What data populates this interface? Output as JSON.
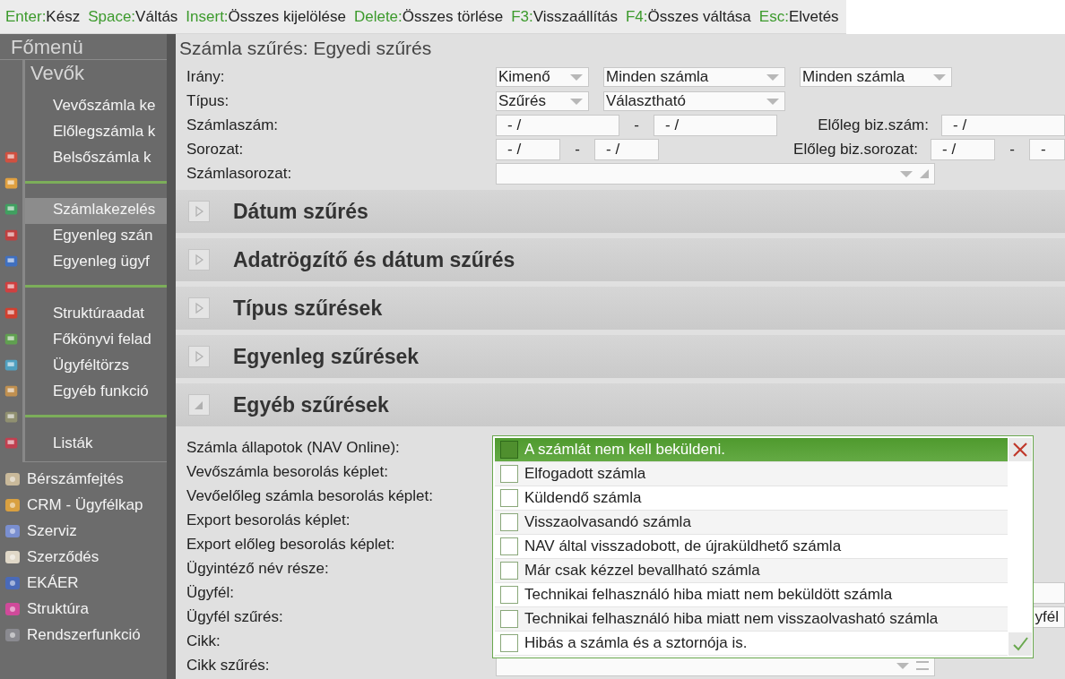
{
  "shortcuts": [
    {
      "key": "Enter:",
      "action": "Kész"
    },
    {
      "key": "Space:",
      "action": "Váltás"
    },
    {
      "key": "Insert:",
      "action": "Összes kijelölése"
    },
    {
      "key": "Delete:",
      "action": "Összes törlése"
    },
    {
      "key": "F3:",
      "action": "Visszaállítás"
    },
    {
      "key": "F4:",
      "action": "Összes váltása"
    },
    {
      "key": "Esc:",
      "action": "Elvetés"
    }
  ],
  "sidebar": {
    "title": "Főmenü",
    "submenu": {
      "title": "Vevők",
      "groups": [
        [
          {
            "label": "Vevőszámla ke",
            "selected": false
          },
          {
            "label": "Előlegszámla k",
            "selected": false
          },
          {
            "label": "Belsőszámla k",
            "selected": false
          }
        ],
        [
          {
            "label": "Számlakezelés",
            "selected": true
          },
          {
            "label": "Egyenleg szán",
            "selected": false
          },
          {
            "label": "Egyenleg ügyf",
            "selected": false
          }
        ],
        [
          {
            "label": "Struktúraadat",
            "selected": false
          },
          {
            "label": "Főkönyvi felad",
            "selected": false
          },
          {
            "label": "Ügyféltörzs",
            "selected": false
          },
          {
            "label": "Egyéb funkció",
            "selected": false
          }
        ],
        [
          {
            "label": "Listák",
            "selected": false
          }
        ]
      ]
    },
    "items": [
      "Bérszámfejtés",
      "CRM - Ügyfélkap",
      "Szerviz",
      "Szerződés",
      "EKÁER",
      "Struktúra",
      "Rendszerfunkció"
    ]
  },
  "title": "Számla szűrés: Egyedi szűrés",
  "filters": [
    {
      "label": "Irány:",
      "kind": "selects",
      "selects": [
        "Kimenő",
        "Minden számla",
        "Minden számla"
      ]
    },
    {
      "label": "Típus:",
      "kind": "selects",
      "selects": [
        "Szűrés",
        "Választható"
      ]
    },
    {
      "label": "Számlaszám:",
      "kind": "range",
      "from": "- /",
      "sep": "-",
      "to": "- /",
      "extra_label": "Előleg biz.szám:",
      "extra_from": "- /"
    },
    {
      "label": "Sorozat:",
      "kind": "short_range",
      "from": "- /",
      "sep": "-",
      "to": "- /",
      "extra_label": "Előleg biz.sorozat:",
      "extra_from": "- /",
      "extra_sep": "-",
      "extra_to": "-"
    },
    {
      "label": "Számlasorozat:",
      "kind": "combo"
    }
  ],
  "sections": [
    {
      "title": "Dátum szűrés",
      "expanded": false
    },
    {
      "title": "Adatrögzítő és dátum szűrés",
      "expanded": false
    },
    {
      "title": "Típus szűrések",
      "expanded": false
    },
    {
      "title": "Egyenleg szűrések",
      "expanded": false
    },
    {
      "title": "Egyéb szűrések",
      "expanded": true
    }
  ],
  "other_fields": [
    {
      "label": "Számla állapotok (NAV Online):",
      "kind": "hidden"
    },
    {
      "label": "Vevőszámla besorolás képlet:",
      "kind": "hidden"
    },
    {
      "label": "Vevőelőleg számla besorolás képlet:",
      "kind": "hidden"
    },
    {
      "label": "Export besorolás képlet:",
      "kind": "hidden"
    },
    {
      "label": "Export előleg besorolás képlet:",
      "kind": "hidden"
    },
    {
      "label": "Ügyintéző név része:",
      "kind": "hidden"
    },
    {
      "label": "Ügyfél:",
      "kind": "field"
    },
    {
      "label": "Ügyfél szűrés:",
      "kind": "field",
      "value": "yfél"
    },
    {
      "label": "Cikk:",
      "kind": "hidden"
    },
    {
      "label": "Cikk szűrés:",
      "kind": "combo"
    }
  ],
  "status_popup": {
    "items": [
      {
        "label": "A számlát nem kell beküldeni.",
        "checked": false,
        "selected": true
      },
      {
        "label": "Elfogadott számla",
        "checked": false,
        "selected": false
      },
      {
        "label": "Küldendő számla",
        "checked": false,
        "selected": false
      },
      {
        "label": "Visszaolvasandó számla",
        "checked": false,
        "selected": false
      },
      {
        "label": "NAV által visszadobott, de újraküldhető számla",
        "checked": false,
        "selected": false
      },
      {
        "label": "Már csak kézzel bevallható számla",
        "checked": false,
        "selected": false
      },
      {
        "label": "Technikai felhasználó hiba miatt nem beküldött számla",
        "checked": false,
        "selected": false
      },
      {
        "label": "Technikai felhasználó hiba miatt nem visszaolvasható számla",
        "checked": false,
        "selected": false
      },
      {
        "label": "Hibás a számla és a sztornója is.",
        "checked": false,
        "selected": false
      }
    ]
  }
}
